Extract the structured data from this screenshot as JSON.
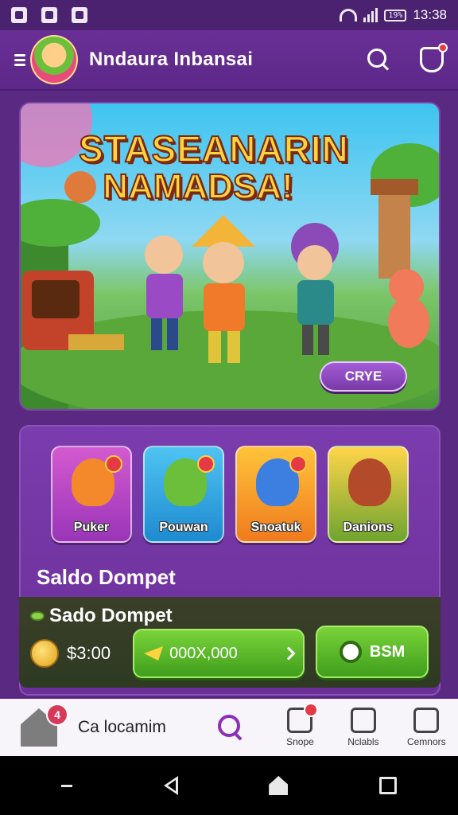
{
  "status_bar": {
    "time": "13:38",
    "battery": "19%"
  },
  "app_bar": {
    "title": "Nndaura Inbansai"
  },
  "banner": {
    "title_line1": "STASEANARIN",
    "title_line2": "NAMADSA!",
    "cta_label": "CRYE"
  },
  "games": [
    {
      "label": "Puker"
    },
    {
      "label": "Pouwan"
    },
    {
      "label": "Snoatuk"
    },
    {
      "label": "Danions"
    }
  ],
  "saldo": {
    "heading": "Saldo Dompet",
    "wallet_title": "Sado Dompet",
    "balance": "$3:00",
    "deposit_value": "000X,000",
    "bsm_label": "BSM"
  },
  "bottom_nav": {
    "home_badge": "4",
    "home_label": "Ca locamim",
    "items": [
      {
        "label": "Snope"
      },
      {
        "label": "Nclabls"
      },
      {
        "label": "Cemnors"
      }
    ]
  }
}
